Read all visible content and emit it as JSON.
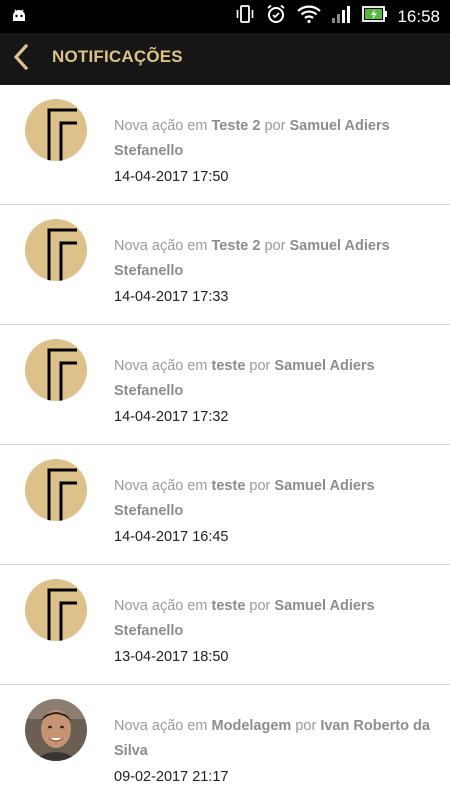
{
  "status_bar": {
    "time": "16:58",
    "icons": [
      "android-icon",
      "vibrate-icon",
      "alarm-icon",
      "wifi-icon",
      "signal-icon",
      "battery-charging-icon"
    ]
  },
  "app_bar": {
    "title": "NOTIFICAÇÕES",
    "back_icon": "chevron-left-icon"
  },
  "colors": {
    "app_bar_bg": "#161616",
    "title": "#dcc28a",
    "avatar_bg": "#dcc28a"
  },
  "notifications": [
    {
      "prefix": "Nova ação em",
      "project": "Teste 2",
      "by": "por",
      "user": "Samuel Adiers Stefanello",
      "date": "14-04-2017 17:50",
      "avatar": "logo"
    },
    {
      "prefix": "Nova ação em",
      "project": "Teste 2",
      "by": "por",
      "user": "Samuel Adiers Stefanello",
      "date": "14-04-2017 17:33",
      "avatar": "logo"
    },
    {
      "prefix": "Nova ação em",
      "project": "teste",
      "by": "por",
      "user": "Samuel Adiers Stefanello",
      "date": "14-04-2017 17:32",
      "avatar": "logo"
    },
    {
      "prefix": "Nova ação em",
      "project": "teste",
      "by": "por",
      "user": "Samuel Adiers Stefanello",
      "date": "14-04-2017 16:45",
      "avatar": "logo"
    },
    {
      "prefix": "Nova ação em",
      "project": "teste",
      "by": "por",
      "user": "Samuel Adiers Stefanello",
      "date": "13-04-2017 18:50",
      "avatar": "logo"
    },
    {
      "prefix": "Nova ação em",
      "project": "Modelagem",
      "by": "por",
      "user": "Ivan Roberto da Silva",
      "date": "09-02-2017 21:17",
      "avatar": "photo"
    }
  ]
}
